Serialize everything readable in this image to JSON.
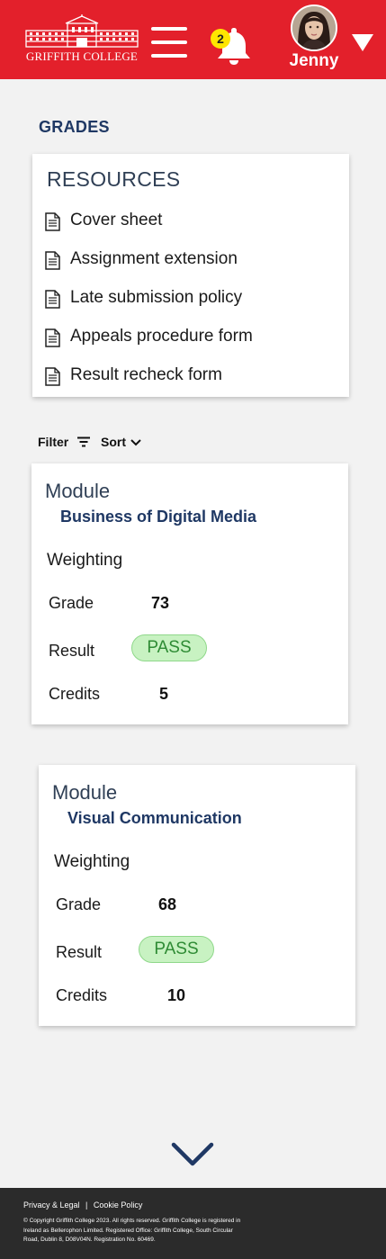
{
  "header": {
    "logo_text": "GRIFFITH COLLEGE",
    "notifications_count": "2",
    "user_name": "Jenny",
    "brand_color": "#e3202b"
  },
  "page_title": "GRADES",
  "resources": {
    "title": "RESOURCES",
    "items": [
      {
        "label": "Cover sheet",
        "icon": "document-icon"
      },
      {
        "label": "Assignment extension",
        "icon": "document-icon"
      },
      {
        "label": "Late submission policy",
        "icon": "document-icon"
      },
      {
        "label": "Appeals procedure form",
        "icon": "document-icon"
      },
      {
        "label": "Result recheck form",
        "icon": "document-icon"
      }
    ]
  },
  "toolbar": {
    "filter_label": "Filter",
    "sort_label": "Sort"
  },
  "modules": [
    {
      "module_label": "Module",
      "name": "Business of Digital Media",
      "weighting_label": "Weighting",
      "grade_label": "Grade",
      "grade": "73",
      "result_label": "Result",
      "result": "PASS",
      "credits_label": "Credits",
      "credits": "5"
    },
    {
      "module_label": "Module",
      "name": "Visual Communication",
      "weighting_label": "Weighting",
      "grade_label": "Grade",
      "grade": "68",
      "result_label": "Result",
      "result": "PASS",
      "credits_label": "Credits",
      "credits": "10"
    }
  ],
  "footer": {
    "privacy_label": "Privacy & Legal",
    "separator": "|",
    "cookie_label": "Cookie Policy",
    "copyright": "© Copyright Griffith College 2023. All rights reserved. Griffith College is registered in Ireland as Bellerophon Limited. Registered Office: Griffith College, South Circular Road, Dublin 8, D08V04N. Registration No. 60469."
  }
}
